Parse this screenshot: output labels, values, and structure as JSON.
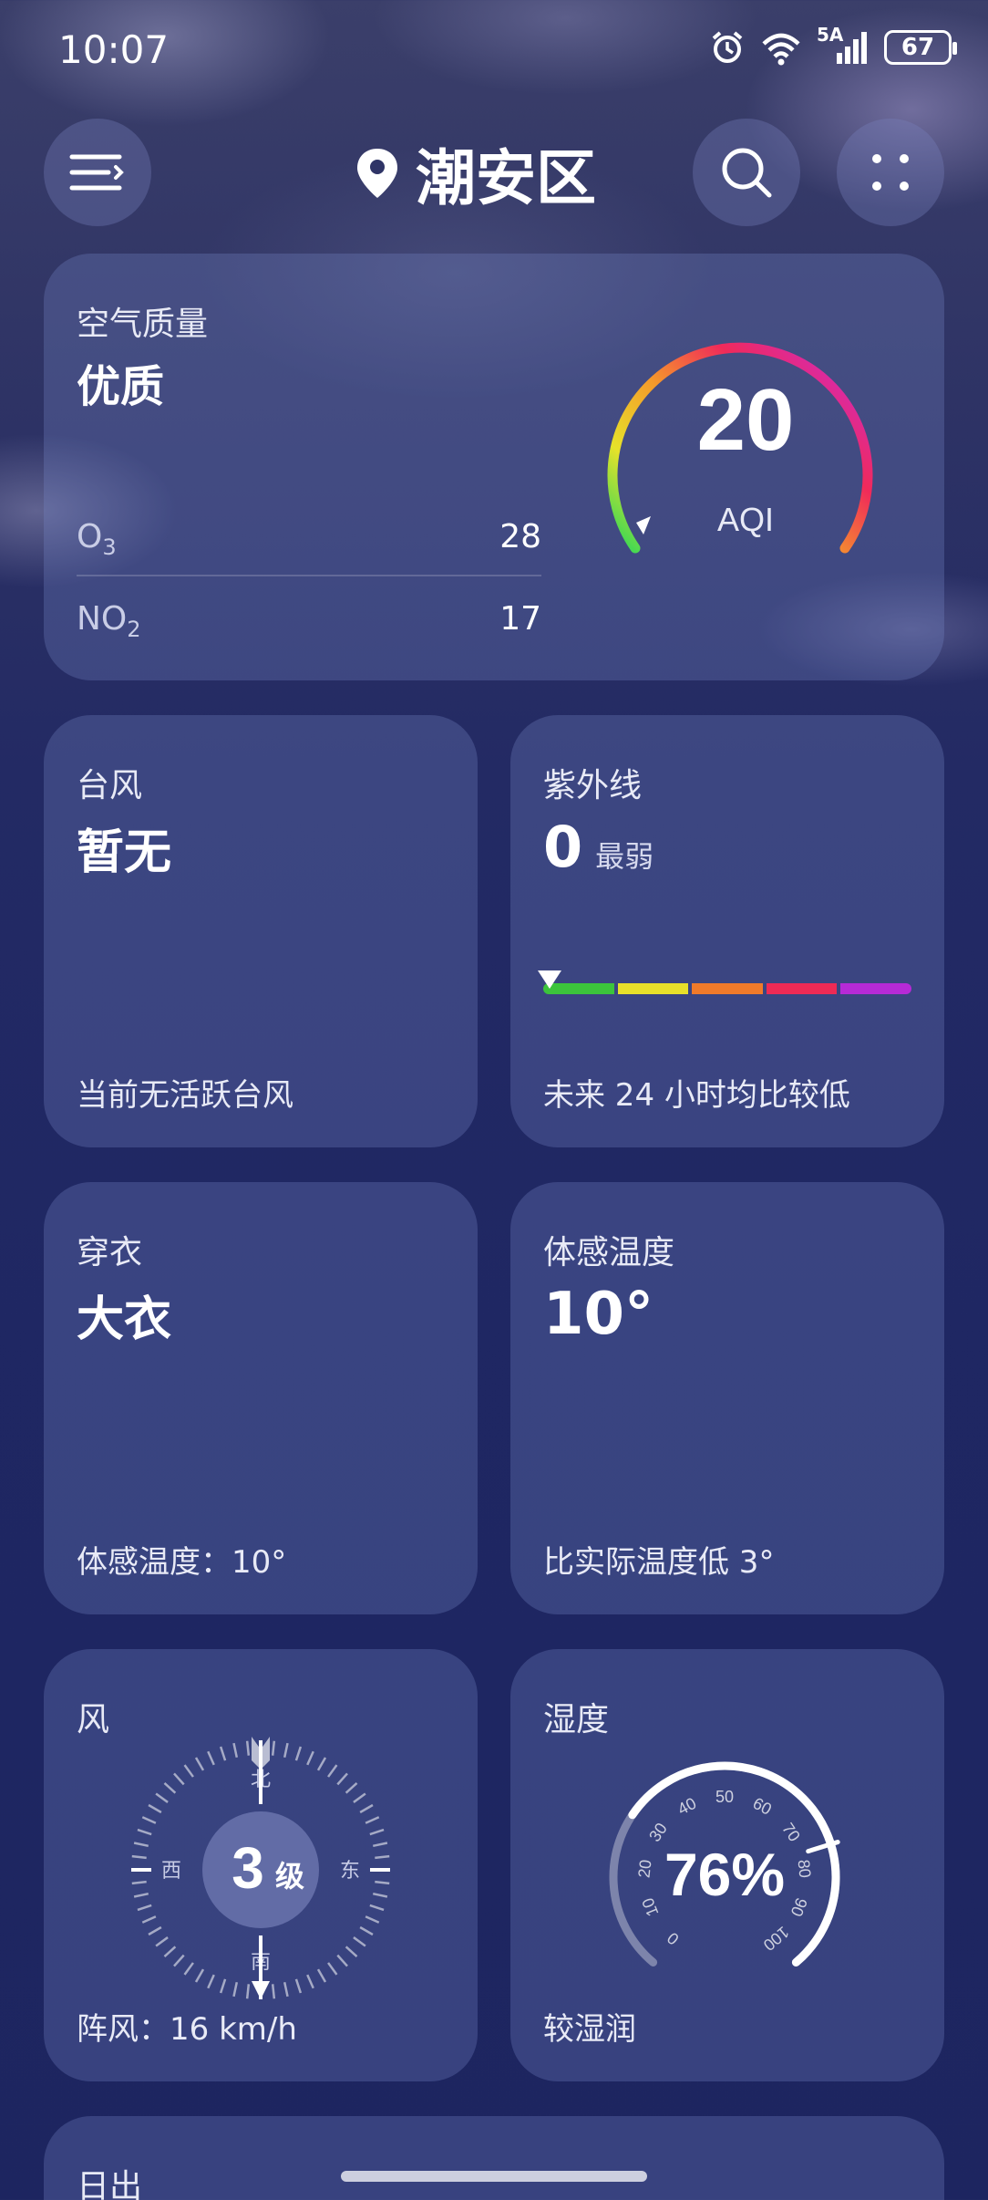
{
  "status_bar": {
    "time": "10:07",
    "network": "5A",
    "battery": "67"
  },
  "header": {
    "location": "潮安区"
  },
  "air_quality": {
    "title": "空气质量",
    "level": "优质",
    "aqi_value": "20",
    "aqi_label": "AQI",
    "pollutants": [
      {
        "name": "O",
        "sub": "3",
        "value": "28"
      },
      {
        "name": "NO",
        "sub": "2",
        "value": "17"
      }
    ]
  },
  "typhoon": {
    "title": "台风",
    "value": "暂无",
    "note": "当前无活跃台风"
  },
  "uv": {
    "title": "紫外线",
    "value": "0",
    "level": "最弱",
    "note": "未来 24 小时均比较低",
    "scale_colors": [
      "#3cc43c",
      "#e8e02a",
      "#f07a2a",
      "#ee2a55",
      "#b62ad6"
    ]
  },
  "clothing": {
    "title": "穿衣",
    "value": "大衣",
    "note": "体感温度：10°"
  },
  "feels_like": {
    "title": "体感温度",
    "value": "10°",
    "note": "比实际温度低 3°"
  },
  "wind": {
    "title": "风",
    "level_number": "3",
    "level_unit": "级",
    "directions": {
      "north": "北",
      "south": "南",
      "east": "东",
      "west": "西"
    },
    "gust": "阵风：16 km/h"
  },
  "humidity": {
    "title": "湿度",
    "value": "76%",
    "percent": 76,
    "ticks": [
      "0",
      "10",
      "20",
      "30",
      "40",
      "50",
      "60",
      "70",
      "80",
      "90",
      "100"
    ],
    "note": "较湿润"
  },
  "sunrise": {
    "title": "日出"
  }
}
